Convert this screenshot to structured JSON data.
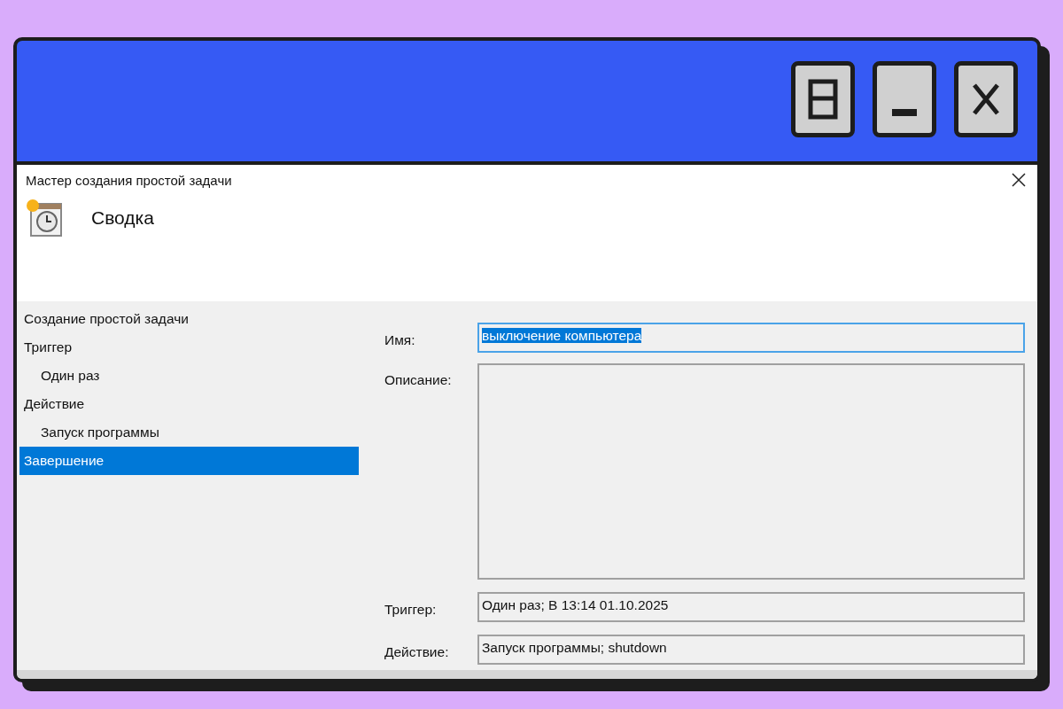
{
  "dialog": {
    "title": "Мастер создания простой задачи",
    "heading": "Сводка"
  },
  "nav": {
    "items": [
      {
        "label": "Создание простой задачи",
        "selected": false
      },
      {
        "label": "Триггер",
        "selected": false,
        "children": [
          {
            "label": "Один раз",
            "selected": false
          }
        ]
      },
      {
        "label": "Действие",
        "selected": false,
        "children": [
          {
            "label": "Запуск программы",
            "selected": false
          }
        ]
      },
      {
        "label": "Завершение",
        "selected": true
      }
    ]
  },
  "fields": [
    {
      "kind": "input",
      "label": "Имя:",
      "value": "выключение компьютера",
      "focused": true
    },
    {
      "kind": "textarea",
      "label": "Описание:",
      "focused": false
    },
    {
      "kind": "readonly",
      "label": "Триггер:",
      "value": "Один раз; В 13:14 01.10.2025",
      "focused": false
    },
    {
      "kind": "readonly",
      "label": "Действие:",
      "value": "Запуск программы; shutdown",
      "focused": false
    }
  ]
}
